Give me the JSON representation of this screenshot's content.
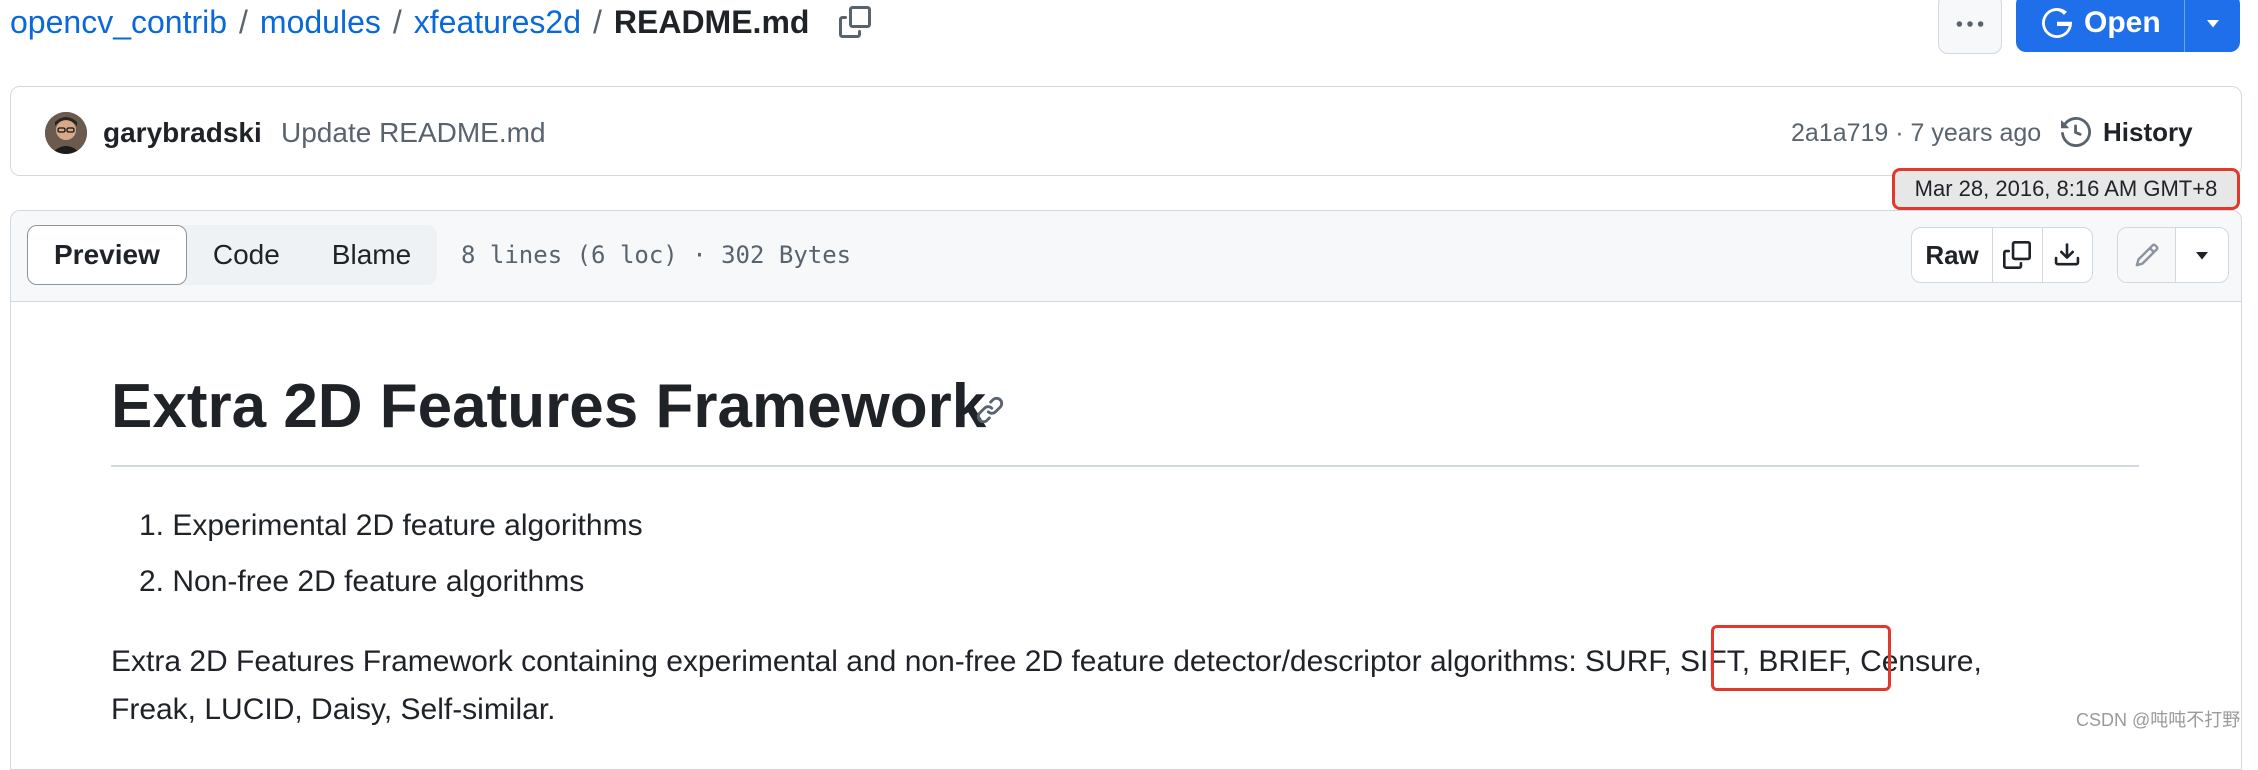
{
  "breadcrumb": {
    "items": [
      "opencv_contrib",
      "modules",
      "xfeatures2d"
    ],
    "separator": "/",
    "current": "README.md",
    "copy_icon": "copy-icon"
  },
  "header_actions": {
    "more_icon": "kebab-horizontal-icon",
    "open_label": "Open",
    "open_icon": "git-open-icon"
  },
  "commit": {
    "author": "garybradski",
    "message": "Update README.md",
    "meta": "2a1a719 · 7 years ago",
    "history_label": "History",
    "tooltip": "Mar 28, 2016, 8:16 AM GMT+8"
  },
  "file_header": {
    "tabs": [
      {
        "label": "Preview",
        "active": true
      },
      {
        "label": "Code",
        "active": false
      },
      {
        "label": "Blame",
        "active": false
      }
    ],
    "info": "8 lines (6 loc) · 302 Bytes",
    "raw_label": "Raw"
  },
  "readme": {
    "title": "Extra 2D Features Framework",
    "list": [
      "1. Experimental 2D feature algorithms",
      "2. Non-free 2D feature algorithms"
    ],
    "paragraph_line1": "Extra 2D Features Framework containing experimental and non-free 2D feature detector/descriptor algorithms: SURF, SIFT, BRIEF, Censure,",
    "paragraph_line2": "Freak, LUCID, Daisy, Self-similar."
  },
  "watermark": "CSDN @吨吨不打野",
  "colors": {
    "link": "#0969da",
    "primary_button": "#1f6feb",
    "highlight_box": "#e2392c",
    "border": "#d1d9e0"
  }
}
